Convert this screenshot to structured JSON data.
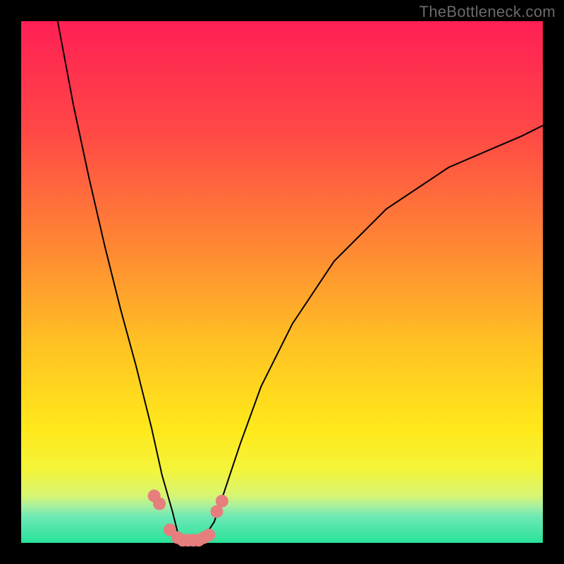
{
  "watermark": {
    "text": "TheBottleneck.com"
  },
  "chart_data": {
    "type": "line",
    "title": "",
    "xlabel": "",
    "ylabel": "",
    "xlim": [
      0,
      100
    ],
    "ylim": [
      0,
      100
    ],
    "grid": false,
    "series": [
      {
        "name": "curve",
        "x": [
          7,
          10,
          13,
          16,
          19,
          22,
          25,
          27,
          29,
          30,
          31,
          33,
          35,
          37,
          39,
          42,
          46,
          52,
          60,
          70,
          82,
          96,
          100
        ],
        "values": [
          100,
          84,
          70,
          57,
          45,
          34,
          22,
          13,
          6,
          2,
          0,
          0,
          1,
          4,
          10,
          19,
          30,
          42,
          54,
          64,
          72,
          78,
          80
        ]
      }
    ],
    "markers": {
      "name": "dots",
      "x": [
        25.5,
        26.5,
        28.5,
        30,
        31,
        32,
        33,
        34,
        35,
        36,
        37.5,
        38.5
      ],
      "values": [
        9,
        7.5,
        2.5,
        1,
        0.5,
        0.5,
        0.5,
        0.5,
        1,
        1.5,
        6,
        8
      ],
      "color": "#e67e7e"
    },
    "gradient_stops": {
      "c0": "#ff1f55",
      "c1": "#ff4a45",
      "c2": "#ff8a33",
      "c3": "#ffc223",
      "c4": "#ffe81a",
      "c5": "#f4f43a",
      "c6": "#d6f573",
      "c7": "#a6f0a0",
      "c8": "#6de8b4",
      "c9": "#28e29a"
    }
  }
}
